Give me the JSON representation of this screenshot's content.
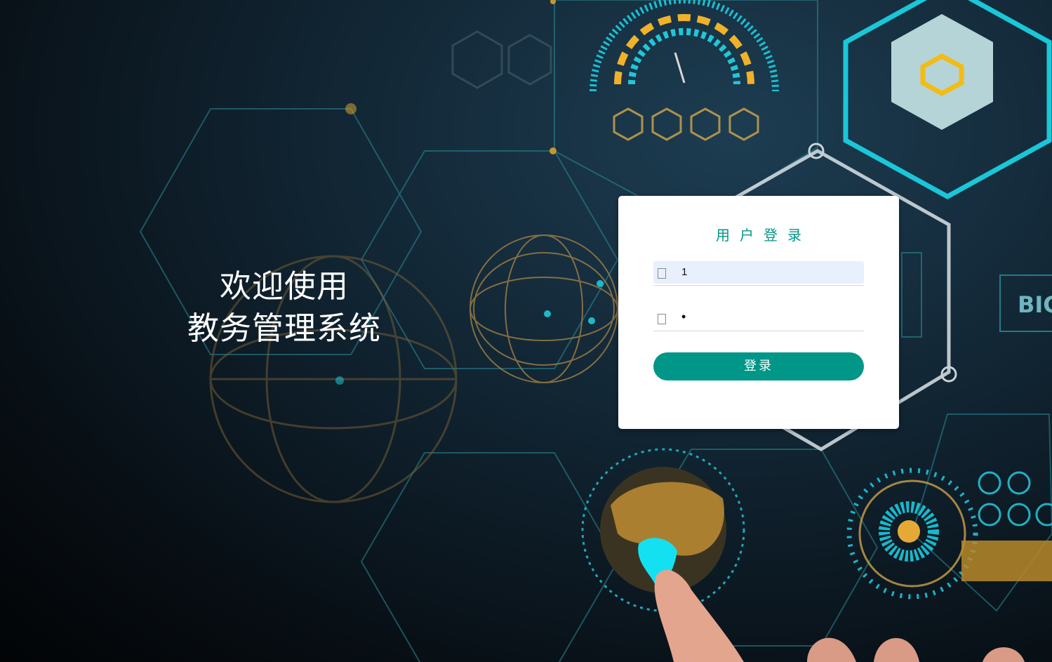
{
  "welcome": {
    "line1": "欢迎使用",
    "line2": "教务管理系统"
  },
  "login": {
    "title": "用户登录",
    "username": {
      "icon": "user-icon",
      "value": "1"
    },
    "password": {
      "icon": "lock-icon",
      "value": "•"
    },
    "button_label": "登录"
  },
  "background": {
    "text": "BIG"
  },
  "colors": {
    "accent": "#009688",
    "autofill": "#e8f0fe",
    "card": "#ffffff"
  }
}
